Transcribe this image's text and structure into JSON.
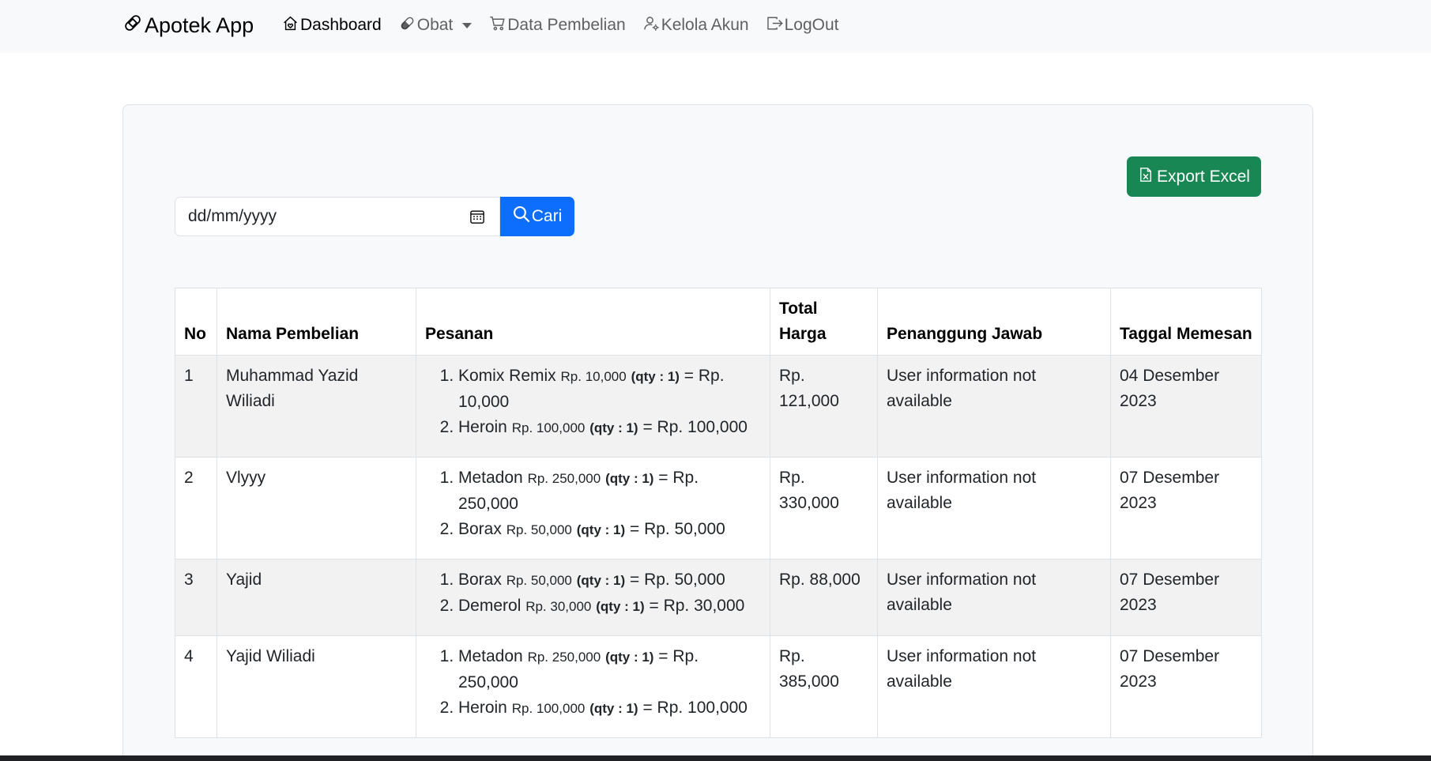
{
  "navbar": {
    "brand": "Apotek App",
    "items": [
      {
        "label": "Dashboard",
        "icon": "house-heart-icon"
      },
      {
        "label": "Obat",
        "icon": "capsule-icon"
      },
      {
        "label": "Data Pembelian",
        "icon": "cart-icon"
      },
      {
        "label": "Kelola Akun",
        "icon": "person-gear-icon"
      },
      {
        "label": "LogOut",
        "icon": "box-arrow-right-icon"
      }
    ]
  },
  "toolbar": {
    "export_label": "Export Excel",
    "date_placeholder": "dd/mm/yyyy",
    "search_label": "Cari"
  },
  "table": {
    "headers": [
      "No",
      "Nama Pembelian",
      "Pesanan",
      "Total Harga",
      "Penanggung Jawab",
      "Taggal Memesan"
    ],
    "rows": [
      {
        "no": "1",
        "name": "Muhammad Yazid Wiliadi",
        "orders": [
          {
            "item": "Komix Remix",
            "price": "Rp. 10,000",
            "qty": "(qty : 1)",
            "subtotal": "= Rp. 10,000"
          },
          {
            "item": "Heroin",
            "price": "Rp. 100,000",
            "qty": "(qty : 1)",
            "subtotal": "= Rp. 100,000"
          }
        ],
        "total": "Rp. 121,000",
        "pic": "User information not available",
        "date": "04 Desember 2023"
      },
      {
        "no": "2",
        "name": "Vlyyy",
        "orders": [
          {
            "item": "Metadon",
            "price": "Rp. 250,000",
            "qty": "(qty : 1)",
            "subtotal": "= Rp. 250,000"
          },
          {
            "item": "Borax",
            "price": "Rp. 50,000",
            "qty": "(qty : 1)",
            "subtotal": "= Rp. 50,000"
          }
        ],
        "total": "Rp. 330,000",
        "pic": "User information not available",
        "date": "07 Desember 2023"
      },
      {
        "no": "3",
        "name": "Yajid",
        "orders": [
          {
            "item": "Borax",
            "price": "Rp. 50,000",
            "qty": "(qty : 1)",
            "subtotal": "= Rp. 50,000"
          },
          {
            "item": "Demerol",
            "price": "Rp. 30,000",
            "qty": "(qty : 1)",
            "subtotal": "= Rp. 30,000"
          }
        ],
        "total": "Rp. 88,000",
        "pic": "User information not available",
        "date": "07 Desember 2023"
      },
      {
        "no": "4",
        "name": "Yajid Wiliadi",
        "orders": [
          {
            "item": "Metadon",
            "price": "Rp. 250,000",
            "qty": "(qty : 1)",
            "subtotal": "= Rp. 250,000"
          },
          {
            "item": "Heroin",
            "price": "Rp. 100,000",
            "qty": "(qty : 1)",
            "subtotal": "= Rp. 100,000"
          }
        ],
        "total": "Rp. 385,000",
        "pic": "User information not available",
        "date": "07 Desember 2023"
      }
    ]
  },
  "colors": {
    "primary": "#0d6efd",
    "success": "#198754",
    "navbar_bg": "#f8f9fa"
  }
}
